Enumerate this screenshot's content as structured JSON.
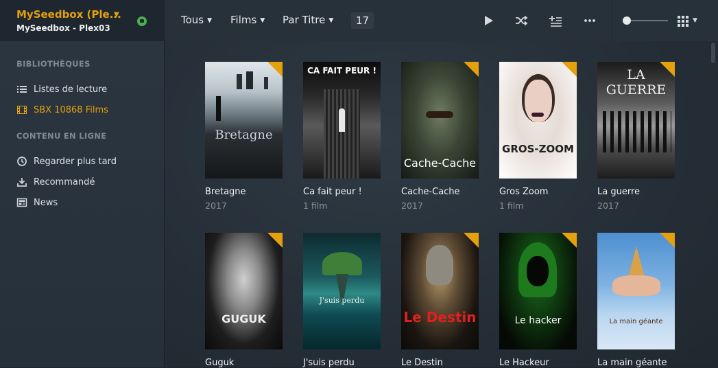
{
  "server": {
    "name": "MySeedbox (Ple...",
    "sub": "MySeedbox - Plex03"
  },
  "sidebar": {
    "section1": "BIBLIOTHÈQUES",
    "items1": [
      {
        "label": "Listes de lecture",
        "icon": "list-icon"
      },
      {
        "label": "SBX 10868 Films",
        "icon": "film-icon"
      }
    ],
    "section2": "CONTENU EN LIGNE",
    "items2": [
      {
        "label": "Regarder plus tard",
        "icon": "clock-icon"
      },
      {
        "label": "Recommandé",
        "icon": "download-icon"
      },
      {
        "label": "News",
        "icon": "news-icon"
      }
    ]
  },
  "toolbar": {
    "filter": "Tous",
    "type": "Films",
    "sort": "Par Titre",
    "count": "17"
  },
  "colors": {
    "accent": "#e5a00d",
    "sidebar": "#2c3640",
    "background": "#252e37"
  },
  "posters": [
    {
      "title": "Bretagne",
      "sub": "2017",
      "poster_text": "Bretagne"
    },
    {
      "title": "Ca fait peur !",
      "sub": "1 film",
      "poster_text": "CA FAIT PEUR !"
    },
    {
      "title": "Cache-Cache",
      "sub": "2017",
      "poster_text": "Cache-Cache"
    },
    {
      "title": "Gros Zoom",
      "sub": "1 film",
      "poster_text": "GROS-ZOOM"
    },
    {
      "title": "La guerre",
      "sub": "2017",
      "poster_text": "LA GUERRE"
    },
    {
      "title": "Guguk",
      "sub": "",
      "poster_text": "GUGUK"
    },
    {
      "title": "J'suis perdu",
      "sub": "",
      "poster_text": "J'suis perdu"
    },
    {
      "title": "Le Destin",
      "sub": "",
      "poster_text": "Le Destin"
    },
    {
      "title": "Le Hackeur",
      "sub": "",
      "poster_text": "Le hacker"
    },
    {
      "title": "La main géante",
      "sub": "",
      "poster_text": "La main géante"
    }
  ]
}
